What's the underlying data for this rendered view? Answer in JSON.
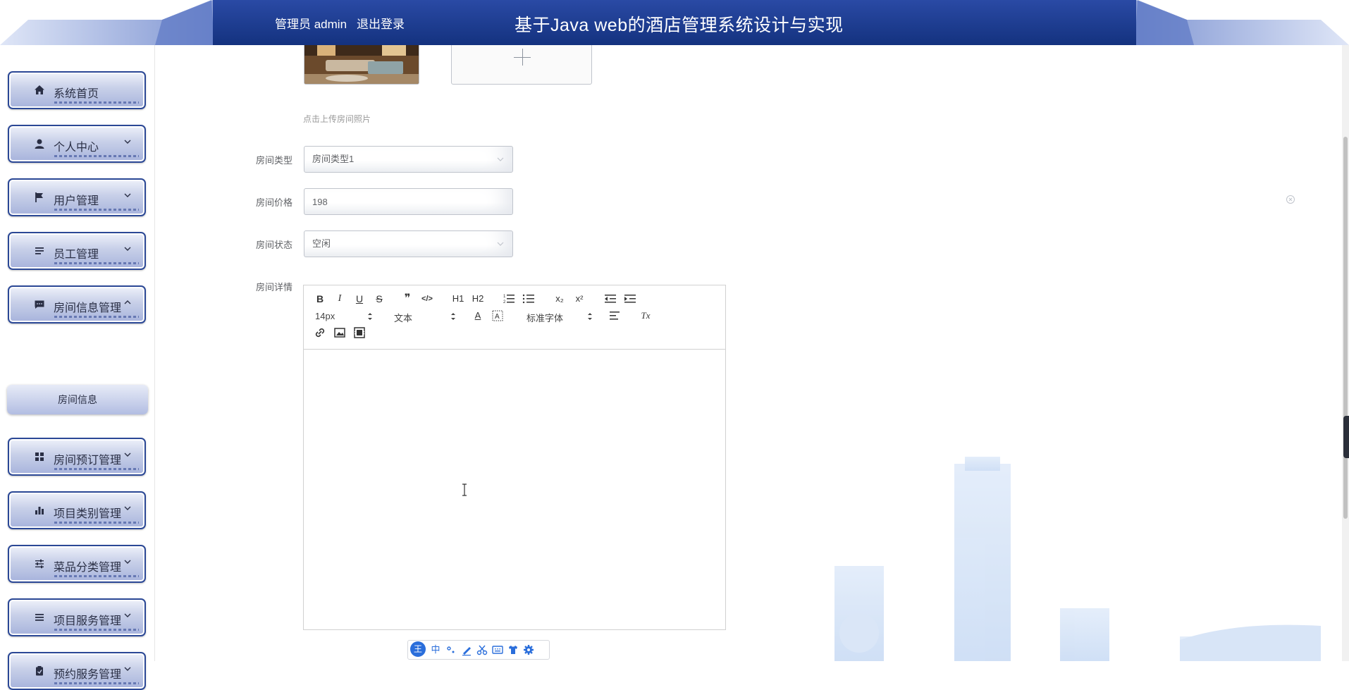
{
  "header": {
    "user_label": "管理员 admin",
    "logout_label": "退出登录",
    "title": "基于Java web的酒店管理系统设计与实现"
  },
  "sidebar": {
    "items": [
      {
        "label": "系统首页",
        "icon": "home-icon"
      },
      {
        "label": "个人中心",
        "icon": "user-icon"
      },
      {
        "label": "用户管理",
        "icon": "flag-icon"
      },
      {
        "label": "员工管理",
        "icon": "list-icon"
      },
      {
        "label": "房间信息管理",
        "icon": "chat-icon"
      },
      {
        "label": "房间预订管理",
        "icon": "grid-icon"
      },
      {
        "label": "项目类别管理",
        "icon": "bar-chart-icon"
      },
      {
        "label": "菜品分类管理",
        "icon": "sliders-icon"
      },
      {
        "label": "项目服务管理",
        "icon": "list-icon"
      },
      {
        "label": "预约服务管理",
        "icon": "clipboard-icon"
      }
    ],
    "submenu": {
      "label": "房间信息"
    }
  },
  "form": {
    "upload_tip": "点击上传房间照片",
    "room_type": {
      "label": "房间类型",
      "value": "房间类型1"
    },
    "room_price": {
      "label": "房间价格",
      "value": "198"
    },
    "room_status": {
      "label": "房间状态",
      "value": "空闲"
    },
    "room_detail": {
      "label": "房间详情"
    }
  },
  "editor": {
    "bold": "B",
    "italic": "I",
    "underline": "U",
    "strike": "S",
    "quote": "❞",
    "code": "</>",
    "h1": "H1",
    "h2": "H2",
    "sub": "x₂",
    "sup": "x²",
    "clean": "Tx",
    "font_size": "14px",
    "text_style": "文本",
    "font_family": "标准字体",
    "font_color": "A"
  },
  "ime": {
    "logo": "王",
    "mode": "中"
  },
  "colors": {
    "header_blue": "#1c3b8f",
    "menu_border": "#2b4896"
  }
}
